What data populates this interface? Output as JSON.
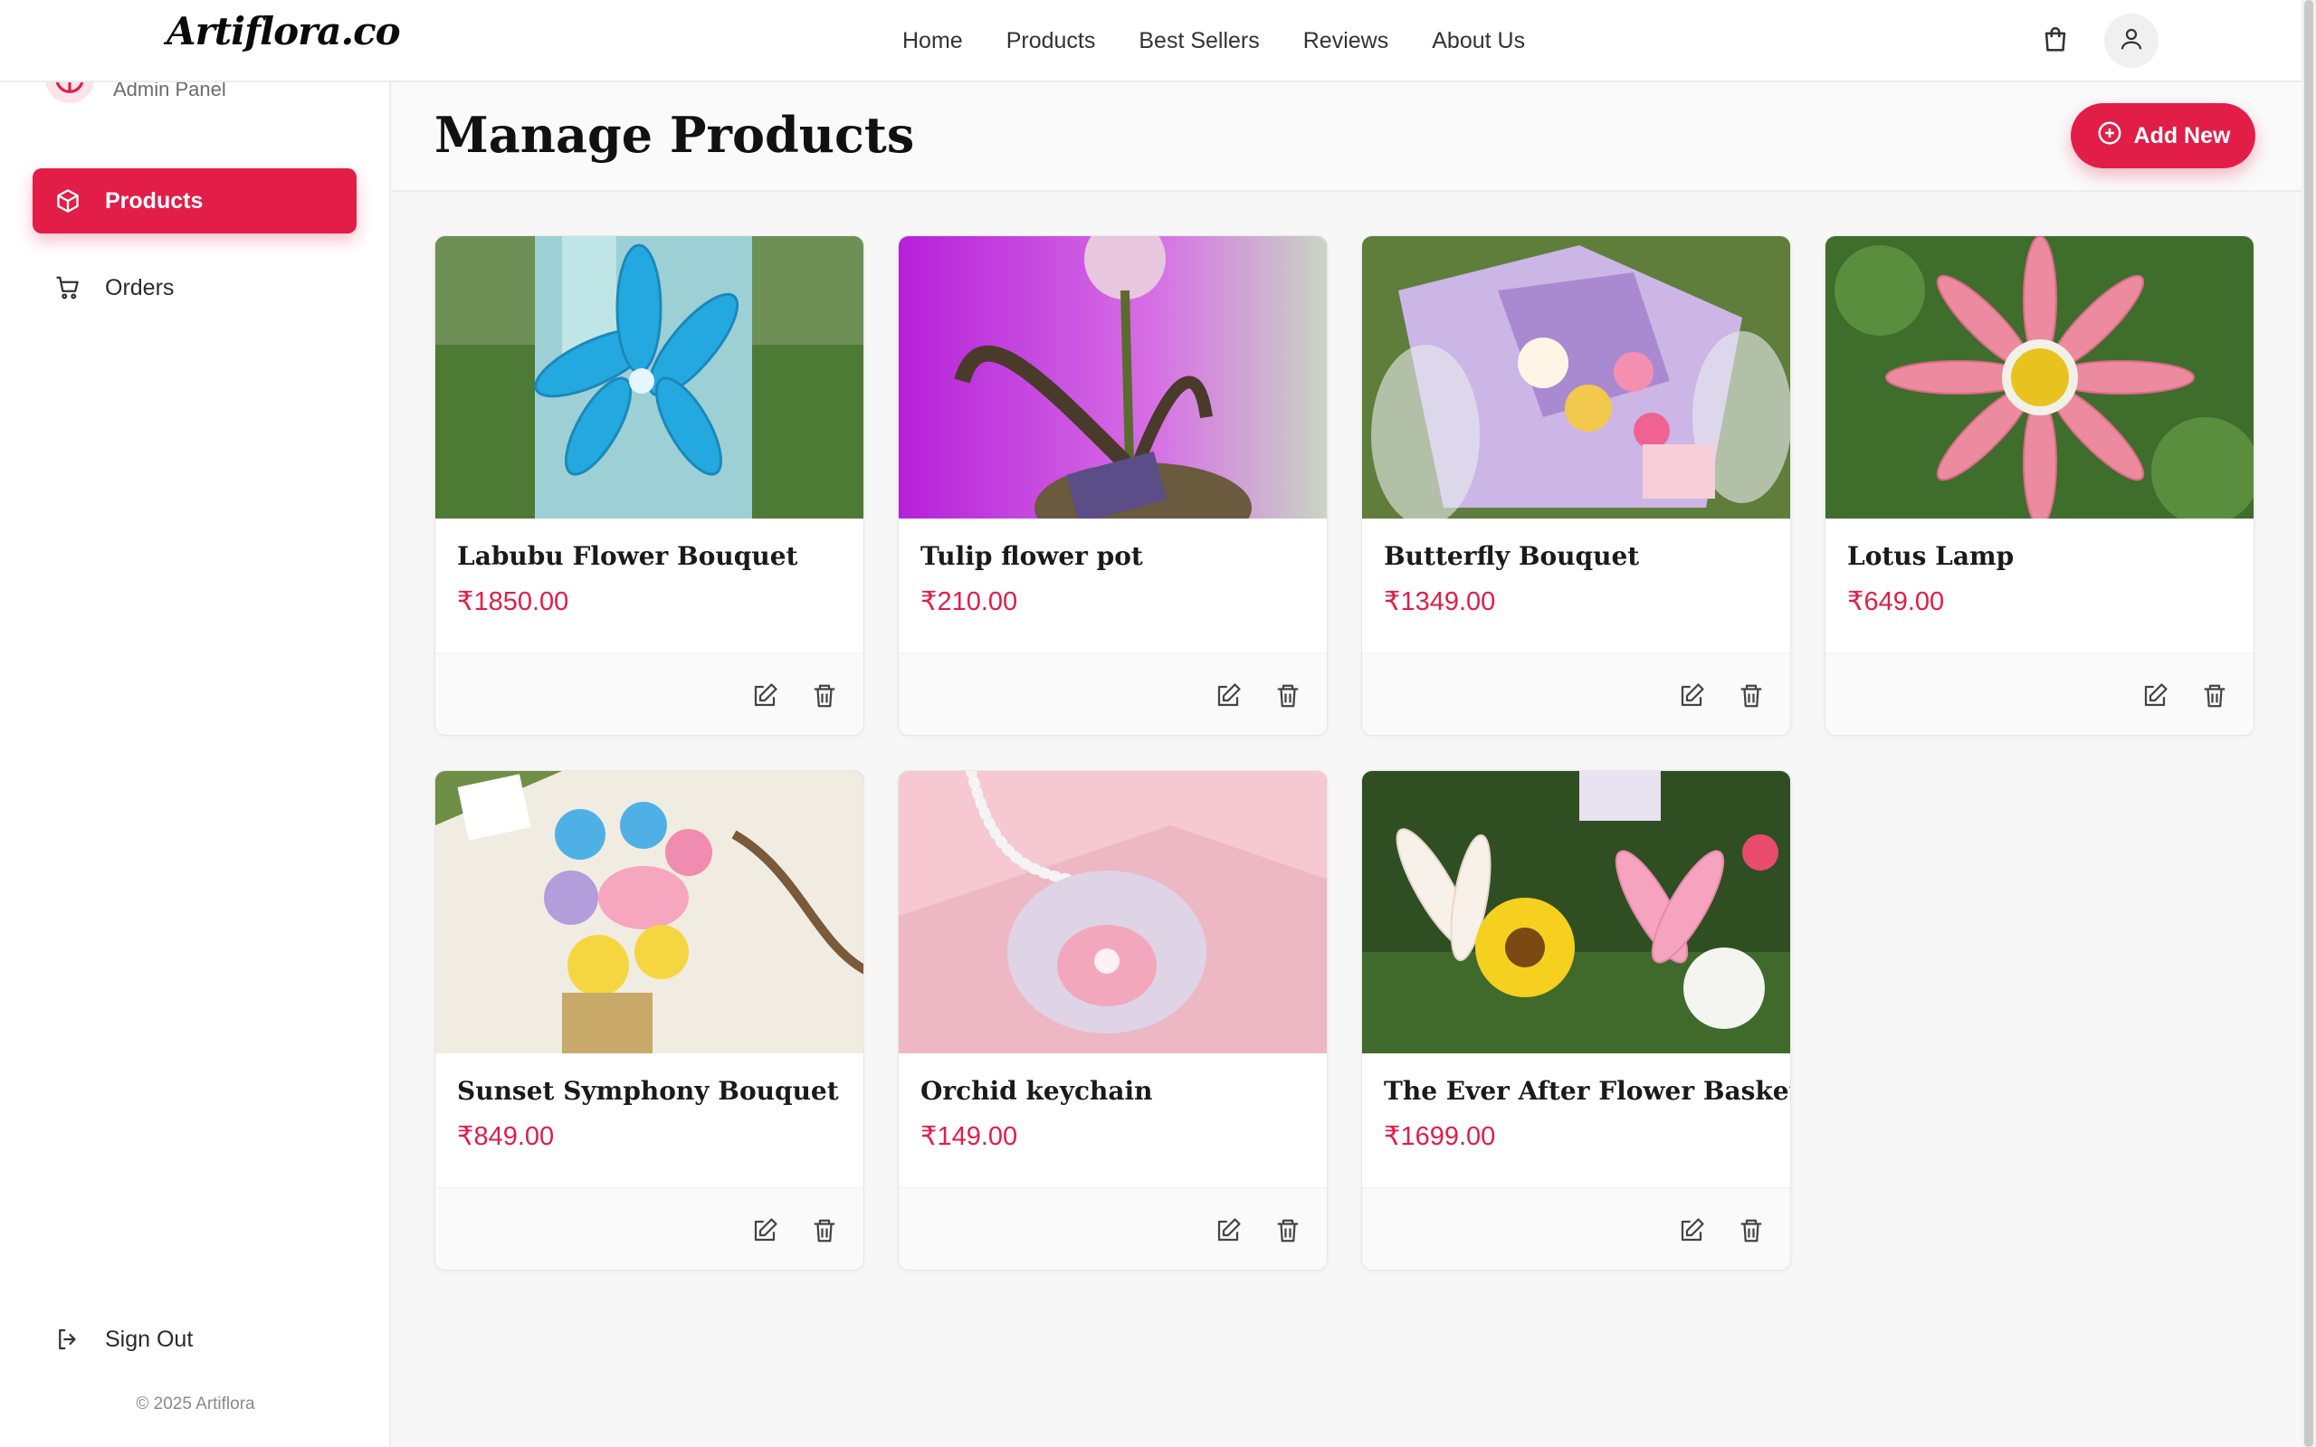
{
  "brand": "Artiflora.co",
  "nav": [
    "Home",
    "Products",
    "Best Sellers",
    "Reviews",
    "About Us"
  ],
  "icons": {
    "cart": "shopping-bag-icon",
    "user": "user-icon",
    "products": "box-icon",
    "orders": "cart-icon",
    "signout": "logout-icon",
    "add": "plus-circle-icon",
    "edit": "edit-icon",
    "delete": "trash-icon"
  },
  "colors": {
    "accent": "#e11d48",
    "background": "#f7f7f7"
  },
  "sidebar": {
    "subtitle": "Admin Panel",
    "items": [
      {
        "label": "Products",
        "active": true
      },
      {
        "label": "Orders",
        "active": false
      }
    ],
    "signout": "Sign Out",
    "copyright": "© 2025 Artiflora"
  },
  "main": {
    "title": "Manage Products",
    "add_label": "Add New",
    "products": [
      {
        "name": "Labubu Flower Bouquet",
        "price": "₹1850.00"
      },
      {
        "name": "Tulip flower pot",
        "price": "₹210.00"
      },
      {
        "name": "Butterfly Bouquet",
        "price": "₹1349.00"
      },
      {
        "name": "Lotus Lamp",
        "price": "₹649.00"
      },
      {
        "name": "Sunset Symphony Bouquet",
        "price": "₹849.00"
      },
      {
        "name": "Orchid keychain",
        "price": "₹149.00"
      },
      {
        "name": "The Ever After Flower Basket",
        "price": "₹1699.00"
      }
    ]
  }
}
